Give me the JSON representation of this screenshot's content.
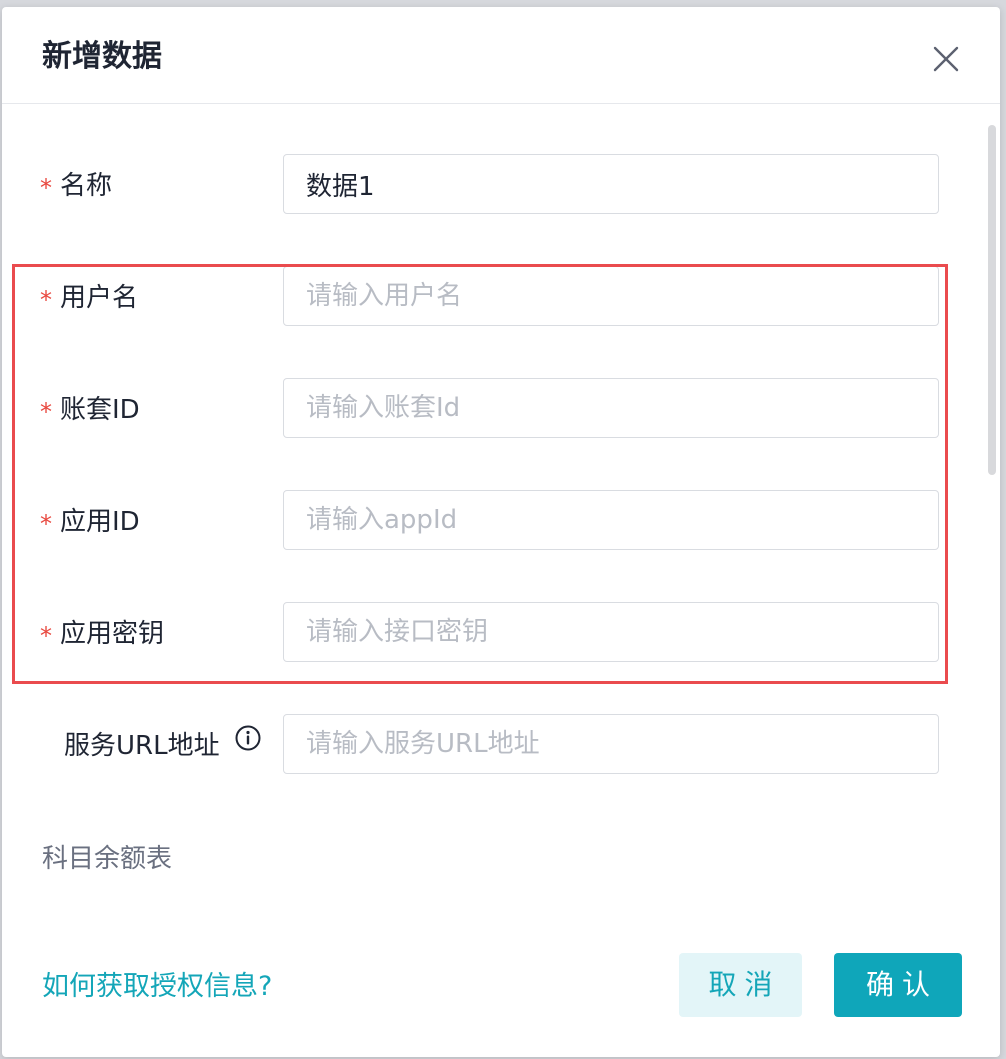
{
  "dialog": {
    "title": "新增数据",
    "close_icon": "close-icon"
  },
  "form": {
    "name": {
      "label": "名称",
      "required_mark": "*",
      "value": "数据1"
    },
    "username": {
      "label": "用户名",
      "required_mark": "*",
      "placeholder": "请输入用户名"
    },
    "account_id": {
      "label": "账套ID",
      "required_mark": "*",
      "placeholder": "请输入账套Id"
    },
    "app_id": {
      "label": "应用ID",
      "required_mark": "*",
      "placeholder": "请输入appId"
    },
    "app_secret": {
      "label": "应用密钥",
      "required_mark": "*",
      "placeholder": "请输入接口密钥"
    },
    "service_url": {
      "label": "服务URL地址",
      "placeholder": "请输入服务URL地址",
      "icon": "info-icon"
    }
  },
  "section": {
    "title": "科目余额表"
  },
  "footer": {
    "help_link": "如何获取授权信息?",
    "cancel_label": "取消",
    "confirm_label": "确认"
  },
  "colors": {
    "accent": "#0fa6ba",
    "required": "#e8483f",
    "highlight_border": "#ea4b4e"
  }
}
